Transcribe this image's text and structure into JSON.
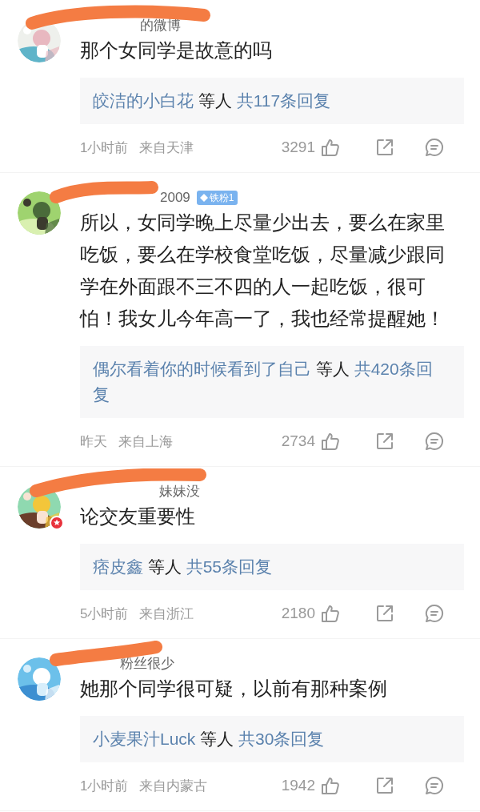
{
  "comments": [
    {
      "username": "的微博",
      "verified": false,
      "text": "那个女同学是故意的吗",
      "replies": {
        "names": "皎洁的小白花",
        "joiner": "等人",
        "total": "共117条回复"
      },
      "time": "1小时前",
      "location": "来自天津",
      "likes": "3291"
    },
    {
      "username": "2009",
      "fan_badge": "铁粉1",
      "verified": false,
      "text": "所以，女同学晚上尽量少出去，要么在家里吃饭，要么在学校食堂吃饭，尽量减少跟同学在外面跟不三不四的人一起吃饭，很可怕！我女儿今年高一了，我也经常提醒她！",
      "replies": {
        "names": "偶尔看着你的时候看到了自己",
        "joiner": "等人",
        "total": "共420条回复"
      },
      "time": "昨天",
      "location": "来自上海",
      "likes": "2734"
    },
    {
      "username": "妹妹没",
      "verified": true,
      "text": "论交友重要性",
      "replies": {
        "names": "痞皮鑫",
        "joiner": "等人",
        "total": "共55条回复"
      },
      "time": "5小时前",
      "location": "来自浙江",
      "likes": "2180"
    },
    {
      "username": "粉丝很少",
      "verified": false,
      "text": "她那个同学很可疑，以前有那种案例",
      "replies": {
        "names": "小麦果汁Luck",
        "joiner": "等人",
        "total": "共30条回复"
      },
      "time": "1小时前",
      "location": "来自内蒙古",
      "likes": "1942"
    }
  ]
}
